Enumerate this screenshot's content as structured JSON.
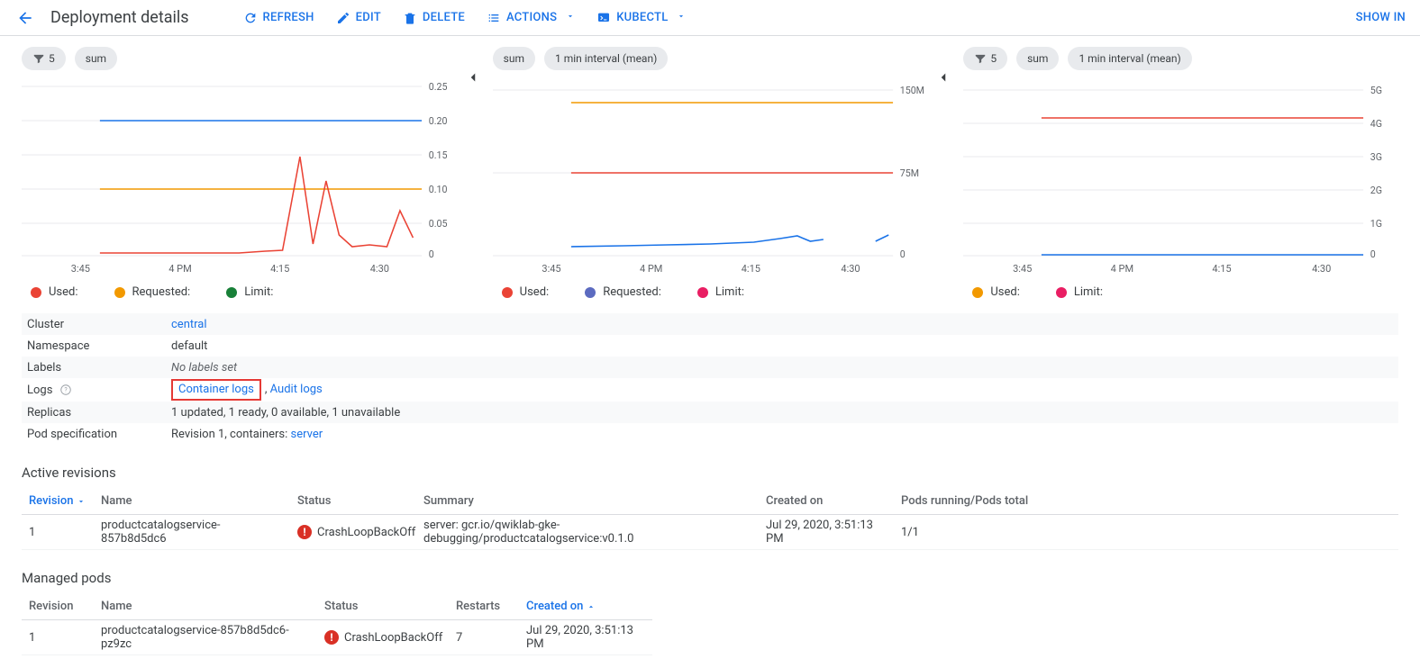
{
  "header": {
    "title": "Deployment details",
    "refresh": "REFRESH",
    "edit": "EDIT",
    "delete": "DELETE",
    "actions": "ACTIONS",
    "kubectl": "KUBECTL",
    "show_in": "SHOW IN"
  },
  "charts": {
    "x_ticks": [
      "3:45",
      "4 PM",
      "4:15",
      "4:30"
    ],
    "legend": {
      "used": "Used:",
      "requested": "Requested:",
      "limit": "Limit:"
    },
    "chips": {
      "filter5": "5",
      "sum": "sum",
      "interval": "1 min interval (mean)"
    }
  },
  "chart_data": [
    {
      "type": "line",
      "xlabel": "",
      "ylabel": "",
      "ylim": [
        0,
        0.25
      ],
      "y_ticks": [
        "0",
        "0.05",
        "0.10",
        "0.15",
        "0.20",
        "0.25"
      ],
      "x": [
        "3:45",
        "3:50",
        "3:55",
        "4:00",
        "4:05",
        "4:10",
        "4:15",
        "4:18",
        "4:20",
        "4:22",
        "4:24",
        "4:26",
        "4:28",
        "4:30",
        "4:33",
        "4:35",
        "4:38",
        "4:40"
      ],
      "series": [
        {
          "name": "Used",
          "color": "#ea4335",
          "values": [
            null,
            null,
            null,
            0.005,
            0.005,
            0.005,
            0.005,
            0.005,
            0.01,
            0.01,
            0.15,
            0.02,
            0.1,
            0.03,
            0.02,
            0.02,
            0.07,
            0.03
          ]
        },
        {
          "name": "Requested",
          "color": "#f29900",
          "values": [
            null,
            null,
            null,
            0.1,
            0.1,
            0.1,
            0.1,
            0.1,
            0.1,
            0.1,
            0.1,
            0.1,
            0.1,
            0.1,
            0.1,
            0.1,
            0.1,
            0.1
          ]
        },
        {
          "name": "Limit",
          "color": "#1a73e8",
          "values": [
            null,
            null,
            null,
            0.2,
            0.2,
            0.2,
            0.2,
            0.2,
            0.2,
            0.2,
            0.2,
            0.2,
            0.2,
            0.2,
            0.2,
            0.2,
            0.2,
            0.2
          ]
        }
      ]
    },
    {
      "type": "line",
      "xlabel": "",
      "ylabel": "",
      "ylim": [
        0,
        150000000
      ],
      "y_ticks": [
        "0",
        "75M",
        "150M"
      ],
      "x": [
        "3:45",
        "3:50",
        "3:55",
        "4:00",
        "4:05",
        "4:10",
        "4:15",
        "4:20",
        "4:25",
        "4:28",
        "4:30",
        "4:33",
        "4:35",
        "4:38",
        "4:40"
      ],
      "series": [
        {
          "name": "Used",
          "color": "#1a73e8",
          "values": [
            null,
            null,
            null,
            9000000,
            9000000,
            9500000,
            10000000,
            11000000,
            12000000,
            15000000,
            13000000,
            null,
            null,
            13000000,
            14000000
          ]
        },
        {
          "name": "Requested",
          "color": "#ea4335",
          "values": [
            null,
            null,
            null,
            75000000,
            75000000,
            75000000,
            75000000,
            75000000,
            75000000,
            75000000,
            75000000,
            75000000,
            75000000,
            75000000,
            75000000
          ]
        },
        {
          "name": "Limit",
          "color": "#f29900",
          "values": [
            null,
            null,
            null,
            140000000,
            140000000,
            140000000,
            140000000,
            140000000,
            140000000,
            140000000,
            140000000,
            140000000,
            140000000,
            140000000,
            140000000
          ]
        }
      ]
    },
    {
      "type": "line",
      "xlabel": "",
      "ylabel": "",
      "ylim": [
        0,
        5000000000
      ],
      "y_ticks": [
        "0",
        "1G",
        "2G",
        "3G",
        "4G",
        "5G"
      ],
      "x": [
        "3:45",
        "3:50",
        "3:55",
        "4:00",
        "4:05",
        "4:10",
        "4:15",
        "4:20",
        "4:25",
        "4:30",
        "4:35",
        "4:40"
      ],
      "series": [
        {
          "name": "Used",
          "color": "#1a73e8",
          "values": [
            null,
            null,
            null,
            50000000,
            50000000,
            50000000,
            50000000,
            50000000,
            50000000,
            50000000,
            50000000,
            50000000
          ]
        },
        {
          "name": "Limit",
          "color": "#ea4335",
          "values": [
            null,
            null,
            null,
            4200000000,
            4200000000,
            4200000000,
            4200000000,
            4200000000,
            4200000000,
            4200000000,
            4200000000,
            4200000000
          ]
        }
      ],
      "legend_override": [
        "Used:",
        "Limit:"
      ],
      "legend_colors": [
        "#f29900",
        "#e91e63"
      ]
    }
  ],
  "details": {
    "cluster_k": "Cluster",
    "cluster_v": "central",
    "namespace_k": "Namespace",
    "namespace_v": "default",
    "labels_k": "Labels",
    "labels_v": "No labels set",
    "logs_k": "Logs",
    "logs_container": "Container logs",
    "logs_audit": "Audit logs",
    "replicas_k": "Replicas",
    "replicas_v": "1 updated, 1 ready, 0 available, 1 unavailable",
    "podspec_k": "Pod specification",
    "podspec_prefix": "Revision 1, containers: ",
    "podspec_link": "server"
  },
  "revisions": {
    "title": "Active revisions",
    "headers": {
      "revision": "Revision",
      "name": "Name",
      "status": "Status",
      "summary": "Summary",
      "created": "Created on",
      "pods": "Pods running/Pods total"
    },
    "row": {
      "revision": "1",
      "name": "productcatalogservice-857b8d5dc6",
      "status": "CrashLoopBackOff",
      "summary": "server: gcr.io/qwiklab-gke-debugging/productcatalogservice:v0.1.0",
      "created": "Jul 29, 2020, 3:51:13 PM",
      "pods": "1/1"
    }
  },
  "pods": {
    "title": "Managed pods",
    "headers": {
      "revision": "Revision",
      "name": "Name",
      "status": "Status",
      "restarts": "Restarts",
      "created": "Created on"
    },
    "row": {
      "revision": "1",
      "name": "productcatalogservice-857b8d5dc6-pz9zc",
      "status": "CrashLoopBackOff",
      "restarts": "7",
      "created": "Jul 29, 2020, 3:51:13 PM"
    }
  }
}
